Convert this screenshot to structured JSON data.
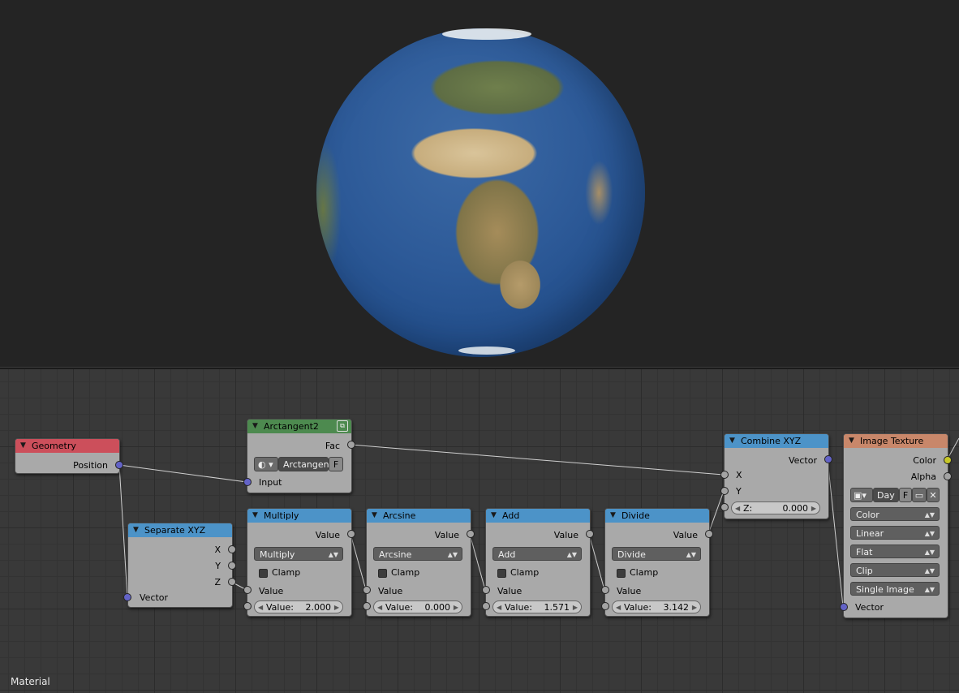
{
  "editor_label": "Material",
  "nodes": {
    "geometry": {
      "title": "Geometry",
      "out": "Position"
    },
    "arctan2": {
      "title": "Arctangent2",
      "out": "Fac",
      "mode": "Arctangent",
      "fake_user": "F",
      "in": "Input"
    },
    "separate": {
      "title": "Separate XYZ",
      "x": "X",
      "y": "Y",
      "z": "Z",
      "in": "Vector"
    },
    "multiply": {
      "title": "Multiply",
      "out": "Value",
      "op": "Multiply",
      "clamp": "Clamp",
      "in": "Value",
      "val_label": "Value:",
      "val": "2.000"
    },
    "arcsine": {
      "title": "Arcsine",
      "out": "Value",
      "op": "Arcsine",
      "clamp": "Clamp",
      "in": "Value",
      "val_label": "Value:",
      "val": "0.000"
    },
    "add": {
      "title": "Add",
      "out": "Value",
      "op": "Add",
      "clamp": "Clamp",
      "in": "Value",
      "val_label": "Value:",
      "val": "1.571"
    },
    "divide": {
      "title": "Divide",
      "out": "Value",
      "op": "Divide",
      "clamp": "Clamp",
      "in": "Value",
      "val_label": "Value:",
      "val": "3.142"
    },
    "combine": {
      "title": "Combine XYZ",
      "out": "Vector",
      "x": "X",
      "y": "Y",
      "z_label": "Z:",
      "z": "0.000"
    },
    "image": {
      "title": "Image Texture",
      "color": "Color",
      "alpha": "Alpha",
      "image_name": "Day",
      "fake_user": "F",
      "color_space": "Color",
      "interpolation": "Linear",
      "projection": "Flat",
      "extension": "Clip",
      "source": "Single Image",
      "in": "Vector"
    }
  },
  "colors": {
    "geometry_header": "#cc4f5b",
    "converter_header": "#4c93c8",
    "group_header": "#4d8a4f",
    "texture_header": "#c8876a"
  },
  "icons": [
    "collapse-triangle-icon",
    "node-group-icon",
    "image-browse-icon",
    "open-folder-icon",
    "close-icon"
  ]
}
